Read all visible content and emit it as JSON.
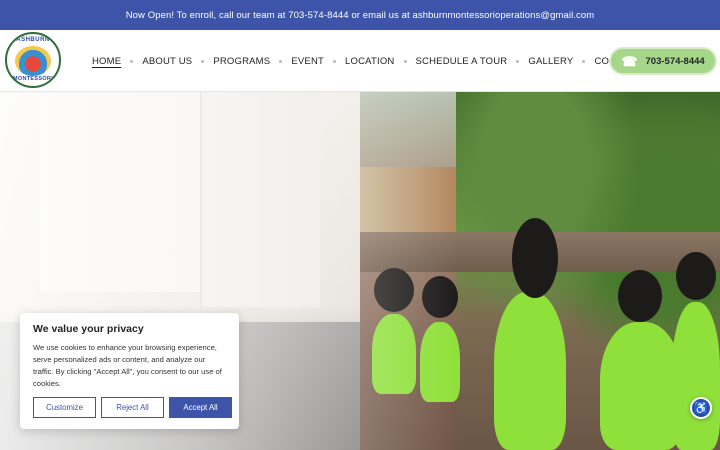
{
  "topbar": {
    "message": "Now Open! To enroll, call our team at 703-574-8444 or email us at ashburnmontessorioperations@gmail.com"
  },
  "logo": {
    "top_text": "ASHBURN",
    "bottom_text": "MONTESSORI"
  },
  "nav": {
    "items": [
      {
        "label": "HOME",
        "active": true
      },
      {
        "label": "ABOUT US"
      },
      {
        "label": "PROGRAMS"
      },
      {
        "label": "EVENT"
      },
      {
        "label": "LOCATION"
      },
      {
        "label": "SCHEDULE A TOUR"
      },
      {
        "label": "GALLERY"
      },
      {
        "label": "CONTACT US"
      }
    ]
  },
  "phone": {
    "label": "703-574-8444",
    "icon": "phone-icon",
    "color": "#a5d68a"
  },
  "cookie": {
    "title": "We value your privacy",
    "text": "We use cookies to enhance your browsing experience, serve personalized ads or content, and analyze our traffic. By clicking \"Accept All\", you consent to our use of cookies.",
    "customize_label": "Customize",
    "reject_label": "Reject All",
    "accept_label": "Accept All"
  },
  "accessibility": {
    "icon": "accessibility-icon"
  },
  "colors": {
    "brand_blue": "#3e54a8",
    "accent_green": "#a5d68a"
  }
}
